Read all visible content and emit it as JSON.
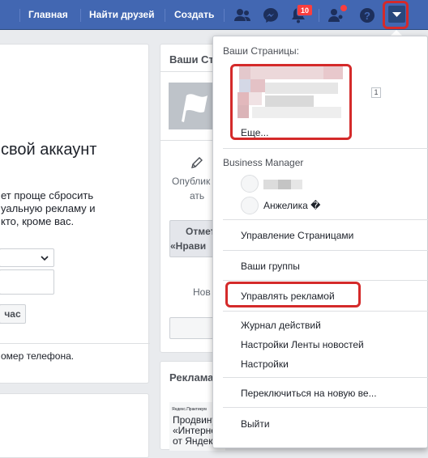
{
  "topbar": {
    "nav": [
      "Главная",
      "Найти друзей",
      "Создать"
    ],
    "notification_count": "10",
    "icons": [
      "friends-icon",
      "messenger-icon",
      "notifications-icon",
      "friend-requests-icon",
      "help-icon",
      "account-menu-caret-icon"
    ],
    "colors": {
      "bar": "#4267b2",
      "badge": "#fa3e3e",
      "highlight": "#d42a2a"
    }
  },
  "background": {
    "heading": "свой аккаунт",
    "paragraph": [
      "ет проще сбросить",
      "уальную рекламу и",
      "кто, кроме вас."
    ],
    "button": "час",
    "phone_note": "омер телефона.",
    "right_card_title": "Ваши Ст",
    "publish_lines": [
      "Опублик",
      "ать"
    ],
    "mark_lines": [
      "Отмет",
      "«Нрави"
    ],
    "new_label": "Нов",
    "ads_title": "Реклама",
    "ad_small": "Яндекс.Практикум",
    "ad_lines": [
      "Продвину",
      "«Интерне",
      "от Яндекс.Практикум"
    ]
  },
  "dropdown": {
    "pages_header": "Ваши Страницы:",
    "page_count_badge": "1",
    "more_link": "Еще...",
    "business_header": "Business Manager",
    "business_account": "Анжелика �",
    "items": [
      "Управление Страницами",
      "Ваши группы",
      "Управлять рекламой",
      "Журнал действий",
      "Настройки Ленты новостей",
      "Настройки",
      "Переключиться на новую ве...",
      "Выйти"
    ]
  }
}
